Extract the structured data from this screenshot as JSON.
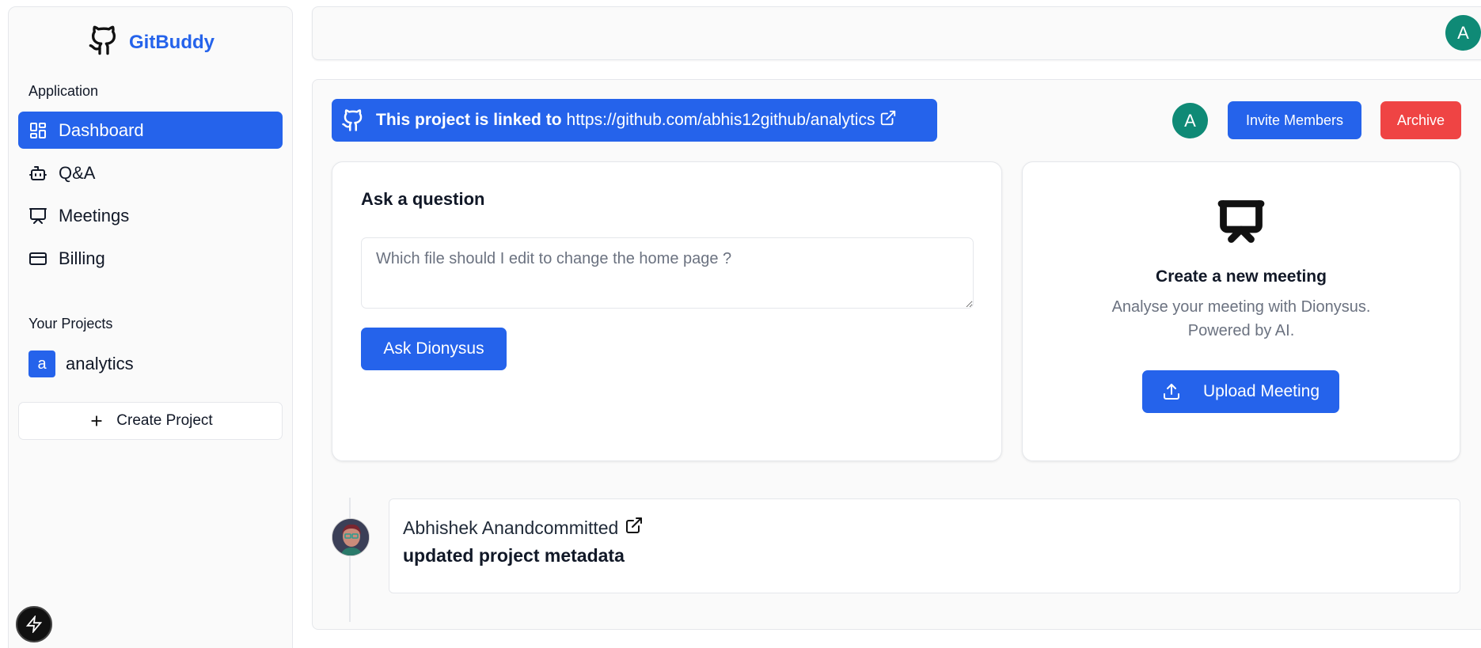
{
  "brand": {
    "name": "GitBuddy",
    "icon": "github-icon"
  },
  "sidebar": {
    "application_label": "Application",
    "items": [
      {
        "label": "Dashboard",
        "icon": "layout-dashboard-icon",
        "active": true
      },
      {
        "label": "Q&A",
        "icon": "bot-icon",
        "active": false
      },
      {
        "label": "Meetings",
        "icon": "presentation-icon",
        "active": false
      },
      {
        "label": "Billing",
        "icon": "credit-card-icon",
        "active": false
      }
    ],
    "projects_label": "Your Projects",
    "projects": [
      {
        "initial": "a",
        "name": "analytics"
      }
    ],
    "create_project_label": "Create Project"
  },
  "topbar": {
    "user_initial": "A"
  },
  "repo_banner": {
    "prefix": "This project is linked to",
    "url": "https://github.com/abhis12github/analytics"
  },
  "header_actions": {
    "member_initial": "A",
    "invite_label": "Invite Members",
    "archive_label": "Archive"
  },
  "ask": {
    "title": "Ask a question",
    "placeholder": "Which file should I edit to change the home page ?",
    "button_label": "Ask Dionysus"
  },
  "meeting": {
    "title": "Create a new meeting",
    "subtitle_line1": "Analyse your meeting with Dionysus.",
    "subtitle_line2": "Powered by AI.",
    "button_label": "Upload Meeting"
  },
  "commits": [
    {
      "author": "Abhishek Anand",
      "verb": "committed",
      "message": "updated project metadata"
    }
  ],
  "colors": {
    "primary": "#2563eb",
    "danger": "#ef4444",
    "avatar": "#0f8a76"
  }
}
